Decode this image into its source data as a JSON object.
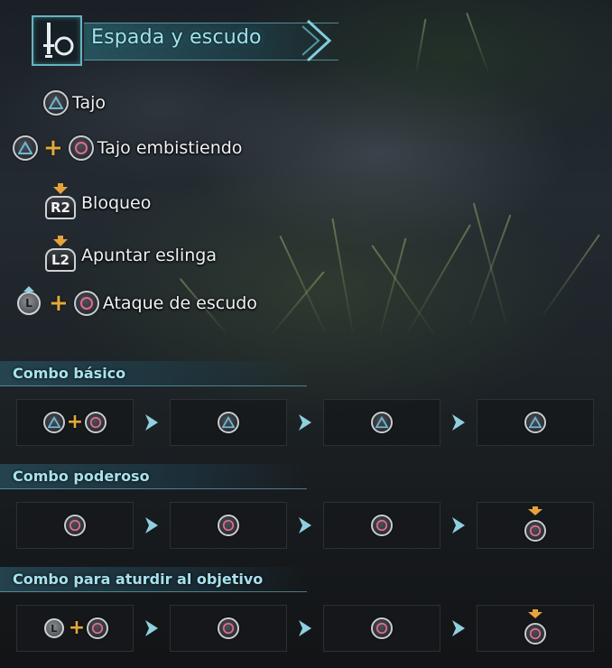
{
  "weapon": {
    "title": "Espada y escudo",
    "icon": "sword-and-shield-icon"
  },
  "controls": [
    {
      "buttons": [
        "triangle"
      ],
      "label": "Tajo"
    },
    {
      "buttons": [
        "triangle",
        "plus",
        "circle"
      ],
      "label": "Tajo embistiendo"
    },
    {
      "buttons": [
        "R2"
      ],
      "label": "Bloqueo"
    },
    {
      "buttons": [
        "L2"
      ],
      "label": "Apuntar eslinga"
    },
    {
      "buttons": [
        "L",
        "plus",
        "circle"
      ],
      "label": "Ataque de escudo"
    }
  ],
  "combos": [
    {
      "title": "Combo básico",
      "steps": [
        [
          "triangle",
          "plus",
          "circle"
        ],
        [
          "triangle"
        ],
        [
          "triangle"
        ],
        [
          "triangle"
        ]
      ]
    },
    {
      "title": "Combo poderoso",
      "steps": [
        [
          "circle"
        ],
        [
          "circle"
        ],
        [
          "circle"
        ],
        [
          "circle-hold"
        ]
      ]
    },
    {
      "title": "Combo para aturdir al objetivo",
      "steps": [
        [
          "L",
          "plus",
          "circle"
        ],
        [
          "circle"
        ],
        [
          "circle"
        ],
        [
          "circle-hold"
        ]
      ]
    }
  ],
  "colors": {
    "accent": "#9fe3ee",
    "triangle": "#6fb6d2",
    "circle": "#e06a8e",
    "plus": "#e3a93a",
    "hold_arrow": "#e7a33b"
  }
}
